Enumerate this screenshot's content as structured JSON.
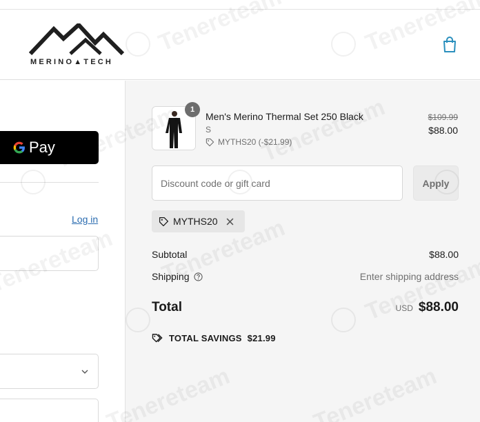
{
  "header": {
    "brand": "MERINO",
    "brand_suffix": "TECH",
    "cart_icon": "shopping-bag-icon"
  },
  "left": {
    "gpay_label": "Pay",
    "login_link": "Log in"
  },
  "order": {
    "product": {
      "name": "Men's Merino Thermal Set 250 Black",
      "variant": "S",
      "quantity": "1",
      "discount_line": "MYTHS20 (-$21.99)",
      "price_original": "$109.99",
      "price_final": "$88.00"
    },
    "discount_placeholder": "Discount code or gift card",
    "apply_label": "Apply",
    "applied_code": "MYTHS20",
    "subtotal_label": "Subtotal",
    "subtotal_value": "$88.00",
    "shipping_label": "Shipping",
    "shipping_value": "Enter shipping address",
    "total_label": "Total",
    "total_currency": "USD",
    "total_value": "$88.00",
    "savings_label": "TOTAL SAVINGS",
    "savings_value": "$21.99"
  },
  "watermark": {
    "text": "Tenereteam"
  },
  "colors": {
    "accent_link": "#2b6cb0",
    "summary_bg": "#f5f5f5",
    "cart_icon": "#2a8fbd"
  }
}
